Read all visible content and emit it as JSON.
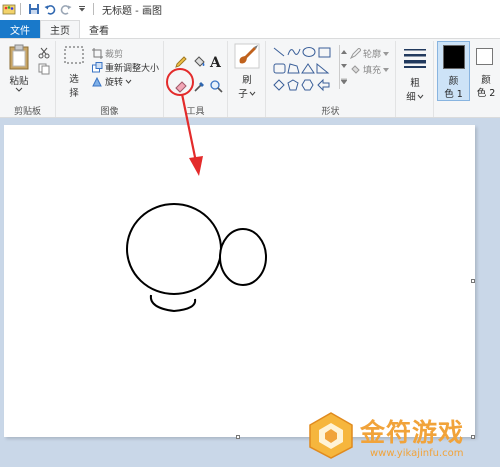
{
  "window": {
    "title": "无标题 - 画图"
  },
  "tabs": {
    "file": "文件",
    "home": "主页",
    "view": "查看"
  },
  "clipboard": {
    "paste": "粘贴",
    "group": "剪贴板"
  },
  "image": {
    "select": "选",
    "select2": "择",
    "crop": "裁剪",
    "resize": "重新调整大小",
    "rotate": "旋转",
    "group": "图像"
  },
  "tools": {
    "group": "工具"
  },
  "brushes": {
    "label1": "刷",
    "label2": "子"
  },
  "shapes": {
    "outline": "轮廓",
    "fill": "填充",
    "group": "形状"
  },
  "size": {
    "label1": "粗",
    "label2": "细"
  },
  "colors": {
    "color1_a": "颜",
    "color1_b": "色 1",
    "color2_a": "颜",
    "color2_b": "色 2",
    "color1_value": "#000000",
    "color2_value": "#ffffff"
  },
  "watermark": {
    "title": "金符游戏",
    "url": "www.yikajinfu.com"
  },
  "accent": {
    "file_tab": "#1979ca",
    "annotation": "#e32b2b",
    "watermark": "#f1a33a"
  }
}
